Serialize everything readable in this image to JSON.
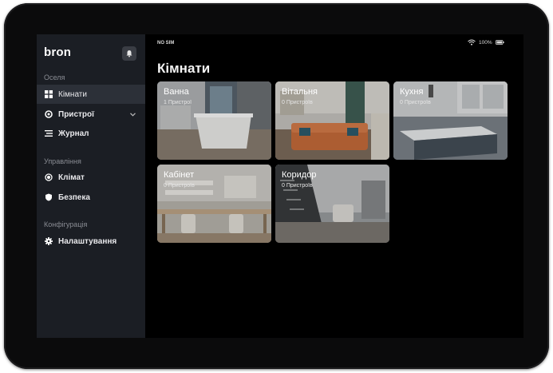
{
  "sidebar": {
    "logo": "bron",
    "sections": [
      {
        "label": "Оселя"
      },
      {
        "label": "Управління"
      },
      {
        "label": "Конфігурація"
      }
    ],
    "items": [
      {
        "label": "Кімнати",
        "icon": "grid-icon",
        "active": true
      },
      {
        "label": "Пристрої",
        "icon": "target-icon"
      },
      {
        "label": "Журнал",
        "icon": "list-icon"
      },
      {
        "label": "Клімат",
        "icon": "radio-icon"
      },
      {
        "label": "Безпека",
        "icon": "shield-icon"
      },
      {
        "label": "Налаштування",
        "icon": "gear-icon"
      }
    ]
  },
  "status_bar": {
    "carrier": "NO SIM",
    "battery": "100%"
  },
  "main": {
    "title": "Кімнати",
    "rooms": [
      {
        "name": "Ванна",
        "devices": "1 Пристрої"
      },
      {
        "name": "Вітальня",
        "devices": "0 Пристроїв"
      },
      {
        "name": "Кухня",
        "devices": "0 Пристроїв"
      },
      {
        "name": "Кабінет",
        "devices": "0 Пристроїв"
      },
      {
        "name": "Коридор",
        "devices": "0 Пристроїв"
      }
    ]
  },
  "colors": {
    "bezel": "#0b0b0c",
    "sidebar": "#1b1e24",
    "active_item": "#2c3038",
    "screen": "#000000"
  }
}
